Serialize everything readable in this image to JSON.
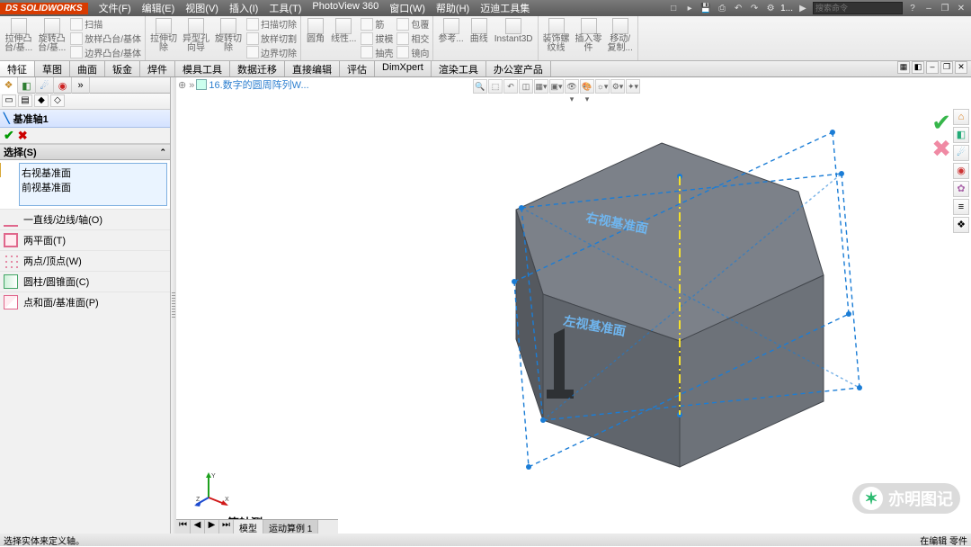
{
  "titlebar": {
    "app": "SOLIDWORKS",
    "menus": [
      "文件(F)",
      "编辑(E)",
      "视图(V)",
      "插入(I)",
      "工具(T)",
      "PhotoView 360",
      "窗口(W)",
      "帮助(H)",
      "迈迪工具集"
    ],
    "doc_suffix": "1...",
    "search_placeholder": "搜索命令"
  },
  "ribbon": {
    "g1": [
      {
        "l": "拉伸凸\n台/基..."
      },
      {
        "l": "旋转凸\n台/基..."
      }
    ],
    "g1s": [
      "扫描",
      "放样凸台/基体",
      "边界凸台/基体"
    ],
    "g2": [
      {
        "l": "拉伸切\n除"
      },
      {
        "l": "异型孔\n向导"
      },
      {
        "l": "旋转切\n除"
      }
    ],
    "g2s": [
      "扫描切除",
      "放样切割",
      "边界切除"
    ],
    "g3": [
      {
        "l": "圆角"
      },
      {
        "l": "线性..."
      }
    ],
    "g3s": [
      "筋",
      "拔模",
      "抽壳"
    ],
    "g3s2": [
      "包覆",
      "相交",
      "镜向"
    ],
    "g4": [
      {
        "l": "参考..."
      },
      {
        "l": "曲线"
      },
      {
        "l": "Instant3D"
      }
    ],
    "g5": [
      {
        "l": "装饰螺\n纹线"
      },
      {
        "l": "插入零\n件"
      },
      {
        "l": "移动/\n复制..."
      }
    ]
  },
  "feature_tabs": [
    "特征",
    "草图",
    "曲面",
    "钣金",
    "焊件",
    "模具工具",
    "数据迁移",
    "直接编辑",
    "评估",
    "DimXpert",
    "渲染工具",
    "办公室产品"
  ],
  "doc_tab": "16.数字的圆周阵列W...",
  "left": {
    "header": "基准轴1",
    "section_title": "选择(S)",
    "selected": [
      "右视基准面",
      "前视基准面"
    ],
    "options": [
      {
        "icon": "line",
        "label": "一直线/边线/轴(O)"
      },
      {
        "icon": "plane",
        "label": "两平面(T)"
      },
      {
        "icon": "pts",
        "label": "两点/顶点(W)"
      },
      {
        "icon": "cyl",
        "label": "圆柱/圆锥面(C)"
      },
      {
        "icon": "ptface",
        "label": "点和面/基准面(P)"
      }
    ]
  },
  "plane_labels": {
    "right": "右视基准面",
    "front": "左视基准面"
  },
  "view_label": "*等轴测",
  "bottom_tabs": [
    "模型",
    "运动算例 1"
  ],
  "status_left": "选择实体来定义轴。",
  "status_right": "在编辑 零件",
  "watermark": "亦明图记"
}
